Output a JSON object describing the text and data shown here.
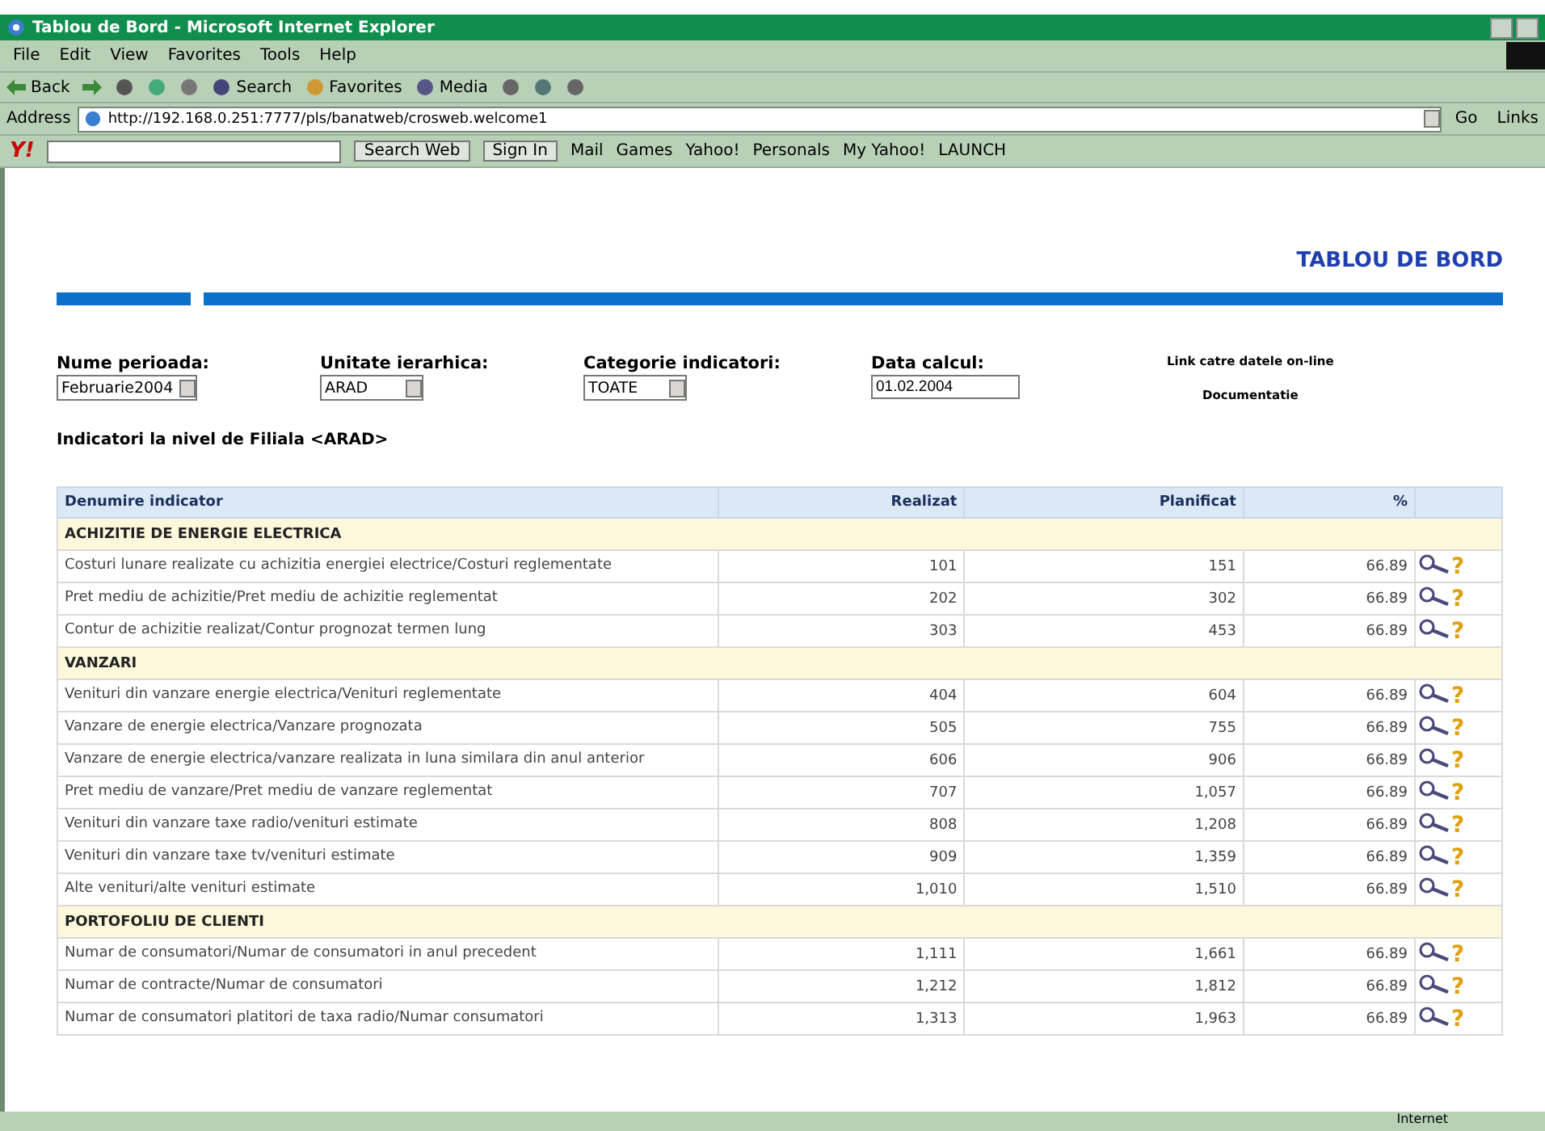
{
  "window": {
    "title": "Tablou de Bord - Microsoft Internet Explorer"
  },
  "menu": [
    "File",
    "Edit",
    "View",
    "Favorites",
    "Tools",
    "Help"
  ],
  "toolbar": [
    {
      "kind": "back",
      "label": "Back"
    },
    {
      "kind": "forward"
    },
    {
      "kind": "stop"
    },
    {
      "kind": "refresh"
    },
    {
      "kind": "home"
    },
    {
      "kind": "search",
      "label": "Search"
    },
    {
      "kind": "favorites",
      "label": "Favorites"
    },
    {
      "kind": "media",
      "label": "Media"
    },
    {
      "kind": "history"
    },
    {
      "kind": "mail"
    },
    {
      "kind": "print"
    }
  ],
  "address": {
    "label": "Address",
    "value": "http://192.168.0.251:7777/pls/banatweb/crosweb.welcome1",
    "go": "Go",
    "links": "Links"
  },
  "yahoo_bar": {
    "logo": "Y!",
    "search_button": "Search Web",
    "sign_in": "Sign In",
    "items": [
      "Mail",
      "Games",
      "Yahoo!",
      "Personals",
      "My Yahoo!",
      "LAUNCH"
    ]
  },
  "page": {
    "heading": "TABLOU DE BORD",
    "filters": [
      {
        "label": "Nume perioada:",
        "kind": "select",
        "value": "Februarie2004"
      },
      {
        "label": "Unitate ierarhica:",
        "kind": "select",
        "value": "ARAD"
      },
      {
        "label": "Categorie indicatori:",
        "kind": "select",
        "value": "TOATE"
      },
      {
        "label": "Data calcul:",
        "kind": "input",
        "value": "01.02.2004"
      }
    ],
    "links": [
      "Link catre datele on-line",
      "Documentatie"
    ],
    "subtitle": "Indicatori la nivel de Filiala <ARAD>",
    "table": {
      "columns": [
        "Denumire indicator",
        "Realizat",
        "Planificat",
        "%"
      ],
      "rows": [
        {
          "kind": "group",
          "name": "ACHIZITIE DE ENERGIE ELECTRICA"
        },
        {
          "kind": "data",
          "name": "Costuri lunare realizate cu achizitia energiei electrice/Costuri reglementate",
          "realizat": "101",
          "planificat": "151",
          "pct": "66.89",
          "help": "?"
        },
        {
          "kind": "data",
          "name": "Pret mediu de achizitie/Pret mediu de achizitie reglementat",
          "realizat": "202",
          "planificat": "302",
          "pct": "66.89",
          "help": "?"
        },
        {
          "kind": "data",
          "name": "Contur de achizitie realizat/Contur prognozat termen lung",
          "realizat": "303",
          "planificat": "453",
          "pct": "66.89",
          "help": "?"
        },
        {
          "kind": "group",
          "name": "VANZARI"
        },
        {
          "kind": "data",
          "name": "Venituri din vanzare energie electrica/Venituri reglementate",
          "realizat": "404",
          "planificat": "604",
          "pct": "66.89",
          "help": "?"
        },
        {
          "kind": "data",
          "name": "Vanzare de energie electrica/Vanzare prognozata",
          "realizat": "505",
          "planificat": "755",
          "pct": "66.89",
          "help": "?"
        },
        {
          "kind": "data",
          "name": "Vanzare de energie electrica/vanzare realizata in luna similara din anul anterior",
          "realizat": "606",
          "planificat": "906",
          "pct": "66.89",
          "help": "?"
        },
        {
          "kind": "data",
          "name": "Pret mediu de vanzare/Pret mediu de vanzare reglementat",
          "realizat": "707",
          "planificat": "1,057",
          "pct": "66.89",
          "help": "?"
        },
        {
          "kind": "data",
          "name": "Venituri din vanzare taxe radio/venituri estimate",
          "realizat": "808",
          "planificat": "1,208",
          "pct": "66.89",
          "help": "?"
        },
        {
          "kind": "data",
          "name": "Venituri din vanzare taxe tv/venituri estimate",
          "realizat": "909",
          "planificat": "1,359",
          "pct": "66.89",
          "help": "?"
        },
        {
          "kind": "data",
          "name": "Alte venituri/alte venituri estimate",
          "realizat": "1,010",
          "planificat": "1,510",
          "pct": "66.89",
          "help": "?"
        },
        {
          "kind": "group",
          "name": "PORTOFOLIU DE CLIENTI"
        },
        {
          "kind": "data",
          "name": "Numar de consumatori/Numar de consumatori in anul precedent",
          "realizat": "1,111",
          "planificat": "1,661",
          "pct": "66.89",
          "help": "?"
        },
        {
          "kind": "data",
          "name": "Numar de contracte/Numar de consumatori",
          "realizat": "1,212",
          "planificat": "1,812",
          "pct": "66.89",
          "help": "?"
        },
        {
          "kind": "data",
          "name": "Numar de consumatori platitori de taxa radio/Numar consumatori",
          "realizat": "1,313",
          "planificat": "1,963",
          "pct": "66.89",
          "help": "?"
        }
      ]
    }
  },
  "status_bar": {
    "zone": "Internet"
  }
}
